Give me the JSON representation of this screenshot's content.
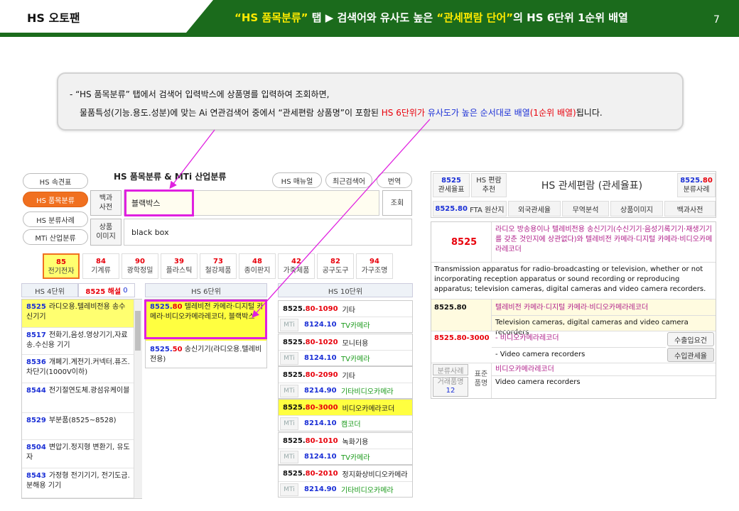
{
  "header": {
    "left_title": "HS 오토팬",
    "title_q1": "“HS 품목분류”",
    "title_mid": " 탭 ▶ 검색어와 유사도 높은 ",
    "title_q2": "“관세편람 단어”",
    "title_end": "의 HS 6단위 1순위 배열",
    "page_number": "7"
  },
  "callout": {
    "line1": "-  “HS 품목분류” 탭에서 검색어 입력박스에 상품명를 입력하여 조회하면,",
    "line2_a": "물품특성(기능.용도.성분)에 맞는 Ai 연관검색어 중에서 “관세편람 상품명”이 포함된 ",
    "line2_b": "HS 6단위가 ",
    "line2_c": "유사도가 높은 순서대로 배열",
    "line2_d": "(1순위 배열)",
    "line2_e": "됩니다."
  },
  "left_panel": {
    "nav": [
      "HS 속견표",
      "HS 품목분류",
      "HS 분류사례",
      "MTi 산업분류"
    ],
    "title": "HS 품목분류  &  MTi 산업분류",
    "top_buttons": [
      "HS 매뉴얼",
      "최근검색어",
      "번역"
    ],
    "label_dict": "백과\n사전",
    "label_img": "상품\n이미지",
    "search_value": "블랙박스",
    "en_value": "black box",
    "search_button": "조회",
    "categories": [
      {
        "code": "85",
        "name": "전기전자"
      },
      {
        "code": "84",
        "name": "기계류"
      },
      {
        "code": "90",
        "name": "광학정밀"
      },
      {
        "code": "39",
        "name": "플라스틱"
      },
      {
        "code": "73",
        "name": "철강제품"
      },
      {
        "code": "48",
        "name": "종이판지"
      },
      {
        "code": "42",
        "name": "가죽제품"
      },
      {
        "code": "82",
        "name": "공구도구"
      },
      {
        "code": "94",
        "name": "가구조명"
      }
    ],
    "col4_head": "HS 4단위",
    "col4_note": "8525 해설",
    "col4_note_num": "0",
    "col6_head": "HS 6단위",
    "col10_head": "HS 10단위",
    "hs4": [
      {
        "code": "8525",
        "name": "라디오용.텔레비전용 송수신기기"
      },
      {
        "code": "8517",
        "name": "전화기,음성.영상기기,자료 송.수신용 기기"
      },
      {
        "code": "8536",
        "name": "개폐기.계전기.커넥터.퓨즈.차단기(1000V이하)"
      },
      {
        "code": "8544",
        "name": "전기절연도체.광섬유케이블"
      },
      {
        "code": "8529",
        "name": "부분품(8525~8528)"
      },
      {
        "code": "8504",
        "name": "변압기.정지형 변환기, 유도자"
      },
      {
        "code": "8543",
        "name": "가정형 전기기기, 전기도금.분해용 기기"
      }
    ],
    "hs6": [
      {
        "code4": "8525.",
        "code2": "80",
        "name": "텔레비전 카메라·디지털 카메라·비디오카메라레코더, 블랙박스"
      },
      {
        "code4": "8525.",
        "code2": "50",
        "name": "송신기기(라디오용.텔레비전용)"
      }
    ],
    "hs10": [
      {
        "c1": "8525.",
        "c2": "80",
        "c3": "-1090",
        "name": "기타",
        "mti": "MTi",
        "k": "8124.10",
        "kn": "TV카메라"
      },
      {
        "c1": "8525.",
        "c2": "80",
        "c3": "-1020",
        "name": "모니터용",
        "mti": "MTi",
        "k": "8124.10",
        "kn": "TV카메라"
      },
      {
        "c1": "8525.",
        "c2": "80",
        "c3": "-2090",
        "name": "기타",
        "mti": "MTi",
        "k": "8214.90",
        "kn": "기타비디오카메라"
      },
      {
        "c1": "8525.",
        "c2": "80",
        "c3": "-3000",
        "name": "비디오카메라코더",
        "mti": "MTi",
        "k": "8214.10",
        "kn": "캠코더"
      },
      {
        "c1": "8525.",
        "c2": "80",
        "c3": "-1010",
        "name": "녹화기용",
        "mti": "MTi",
        "k": "8124.10",
        "kn": "TV카메라"
      },
      {
        "c1": "8525.",
        "c2": "80",
        "c3": "-2010",
        "name": "정지화상비디오카메라",
        "mti": "MTi",
        "k": "8214.90",
        "kn": "기타비디오카메라"
      }
    ]
  },
  "right_panel": {
    "tl_code": "8525",
    "tl_label": "관세율표",
    "tl2": "HS 편람\n추천",
    "title": "HS 관세편람 (관세율표)",
    "tr_code_a": "8525.",
    "tr_code_b": "80",
    "tr_label": "분류사례",
    "tab_code": "8525.80",
    "tabs": [
      "FTA 원산지",
      "외국관세율",
      "무역분석",
      "상품이미지",
      "백과사전"
    ],
    "h4_code": "8525",
    "h4_kr": "라디오 방송용이나 텔레비전용 송신기기(수신기기·음성기록기기·재생기기를 갖춘 것인지에 상관없다)와 텔레비전 카메라·디지털 카메라·비디오카메라레코더",
    "h4_en": "Transmission apparatus for radio-broadcasting or television, whether or not incorporating reception apparatus or sound recording or reproducing apparatus; television cameras, digital cameras and video camera recorders.",
    "h6_code": "8525.80",
    "h6_kr": "텔레비전 카메라·디지털 카메라·비디오카메라레코더",
    "h6_en": "Television cameras, digital cameras and video camera recorders",
    "h10_code": "8525.80-3000",
    "h10_kr": "- 비디오카메라레코더",
    "h10_en": "- Video camera recorders",
    "btn_export": "수출입요건",
    "btn_import": "수입관세율",
    "btn_case": "분류사례",
    "btn_trade": "거래품명",
    "btn_trade_num": "12",
    "std_label": "표준\n품명",
    "std_kr": "비디오카메라레코더",
    "std_en": "Video camera recorders"
  }
}
